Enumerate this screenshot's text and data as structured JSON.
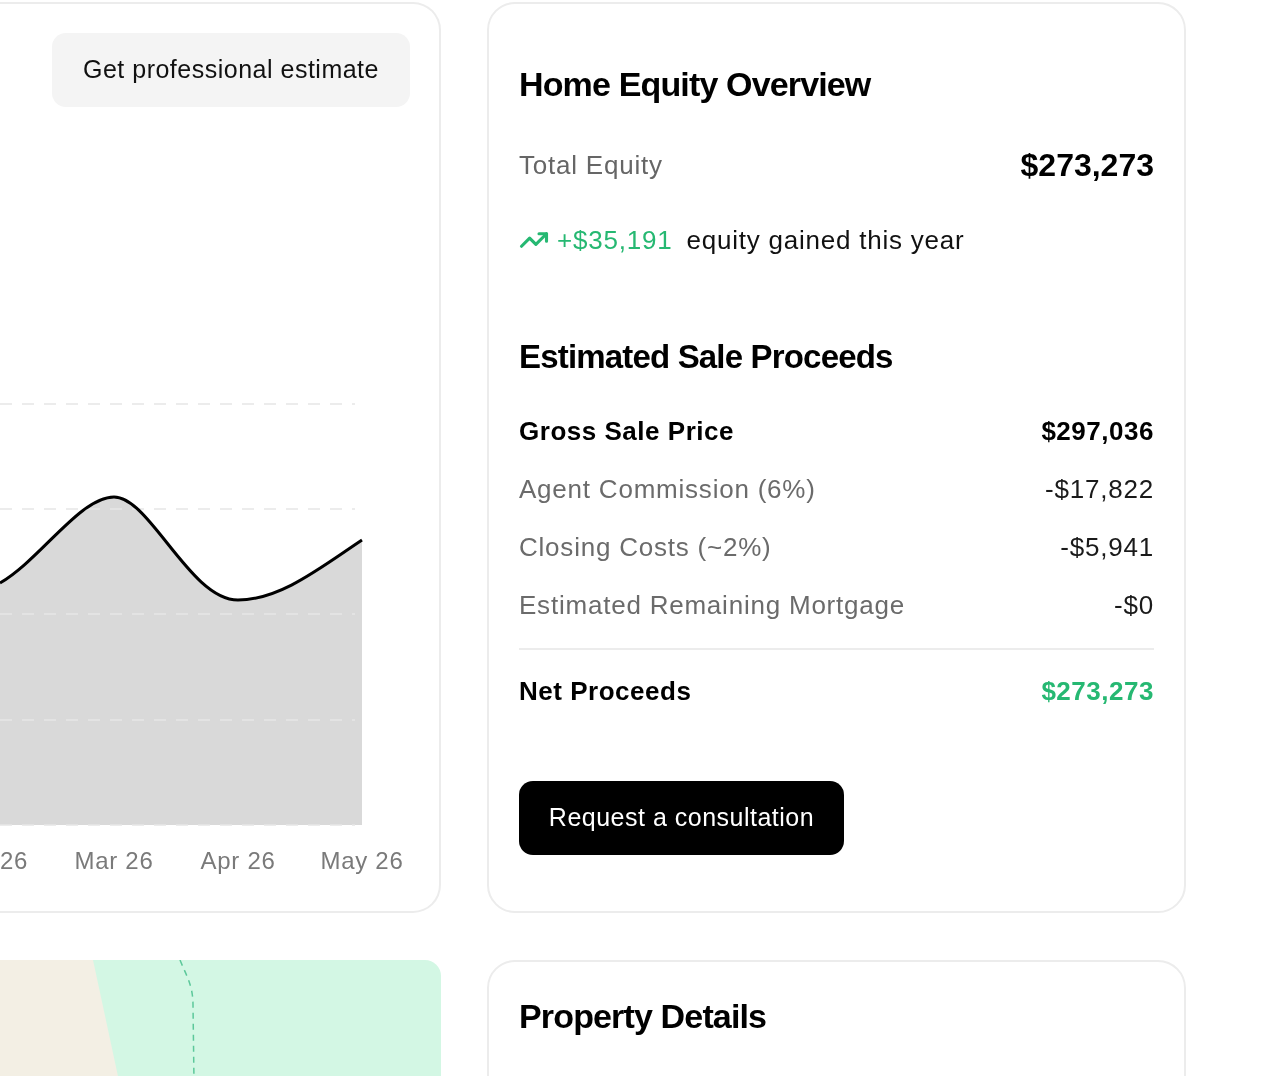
{
  "estimate_card": {
    "button": "Get professional estimate",
    "x_labels": [
      "26",
      "Mar 26",
      "Apr 26",
      "May 26"
    ]
  },
  "equity_card": {
    "title": "Home Equity Overview",
    "total_label": "Total Equity",
    "total_value": "$273,273",
    "gain": {
      "amount": "+$35,191",
      "text": "equity gained this year"
    },
    "proceeds_title": "Estimated Sale Proceeds",
    "rows": [
      {
        "kind": "gross",
        "label": "Gross Sale Price",
        "value": "$297,036"
      },
      {
        "kind": "deduction",
        "label": "Agent Commission (6%)",
        "value": "-$17,822"
      },
      {
        "kind": "deduction",
        "label": "Closing Costs (~2%)",
        "value": "-$5,941"
      },
      {
        "kind": "deduction",
        "label": "Estimated Remaining Mortgage",
        "value": "-$0"
      },
      {
        "kind": "net",
        "label": "Net Proceeds",
        "value": "$273,273"
      }
    ],
    "button": "Request a consultation"
  },
  "property_details": {
    "title": "Property Details"
  }
}
